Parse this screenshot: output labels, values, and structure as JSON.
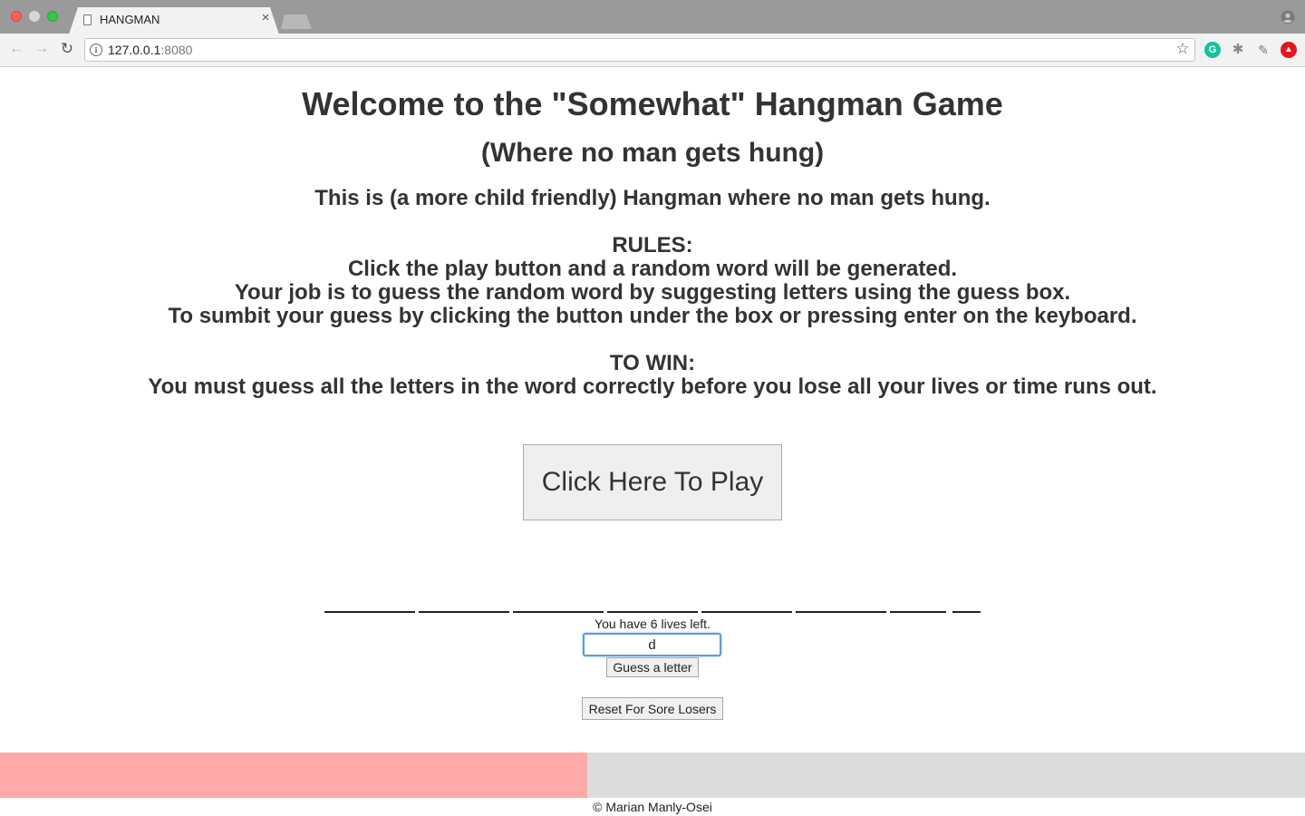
{
  "browser": {
    "tab_title": "HANGMAN",
    "tab_close": "×",
    "url_host": "127.0.0.1",
    "url_port": ":8080"
  },
  "page": {
    "title": "Welcome to the \"Somewhat\" Hangman Game",
    "subtitle": "(Where no man gets hung)",
    "description": "This is (a more child friendly) Hangman where no man gets hung.",
    "rules": {
      "heading": "RULES:",
      "lines": [
        "Click the play button and a random word will be generated.",
        "Your job is to guess the random word by suggesting letters using the guess box.",
        "To sumbit your guess by clicking the button under the box or pressing enter on the keyboard."
      ]
    },
    "win": {
      "heading": "TO WIN:",
      "line": "You must guess all the letters in the word correctly before you lose all your lives or time runs out."
    },
    "play_button": "Click Here To Play",
    "word_blank_count": 8,
    "lives_text": "You have 6 lives left.",
    "guess_input_value": "d",
    "guess_button": "Guess a letter",
    "reset_button": "Reset For Sore Losers",
    "timer_progress_fraction": 0.45,
    "footer": "© Marian Manly-Osei"
  },
  "colors": {
    "timer_fill": "#ffa9a9",
    "timer_track": "#dcdcdc",
    "input_focus": "#5b9dd9"
  }
}
